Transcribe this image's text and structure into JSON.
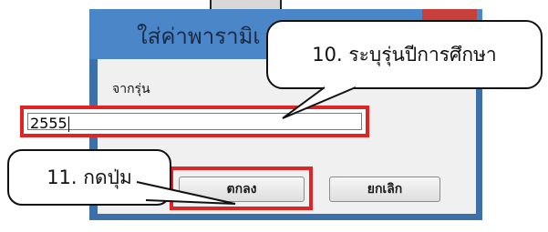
{
  "dialog": {
    "title": "ใส่ค่าพารามิเ",
    "label": "จากรุ่น",
    "input_value": "2555",
    "ok_label": "ตกลง",
    "cancel_label": "ยกเลิก"
  },
  "annotations": {
    "callout_1": "10. ระบุรุ่นปีการศึกษา",
    "callout_2": "11. กดปุ่ม"
  },
  "colors": {
    "title_bar": "#4b86c8",
    "frame": "#3d6fa8",
    "close_red": "#c8403a",
    "highlight_red": "#e02424"
  }
}
